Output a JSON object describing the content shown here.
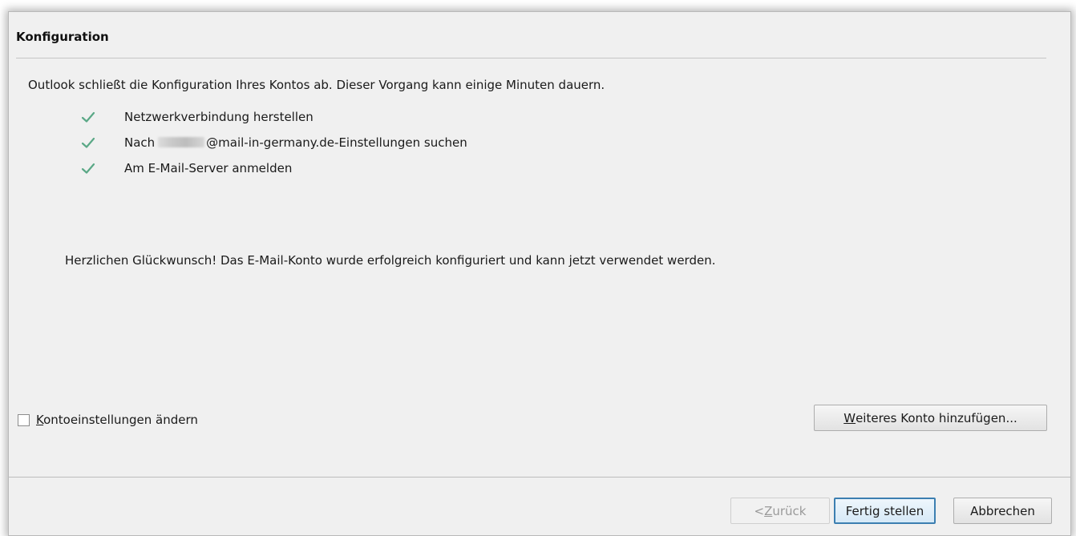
{
  "dialog": {
    "title": "Konfiguration",
    "intro": "Outlook schließt die Konfiguration Ihres Kontos ab. Dieser Vorgang kann einige Minuten dauern.",
    "steps": [
      {
        "status": "check-icon",
        "label": "Netzwerkverbindung herstellen"
      },
      {
        "status": "check-icon",
        "label_prefix": "Nach",
        "label_suffix": "@mail-in-germany.de-Einstellungen suchen"
      },
      {
        "status": "check-icon",
        "label": "Am E-Mail-Server anmelden"
      }
    ],
    "congratulations": "Herzlichen Glückwunsch! Das E-Mail-Konto wurde erfolgreich konfiguriert und kann jetzt verwendet werden."
  },
  "options": {
    "change_settings_accel": "K",
    "change_settings_rest": "ontoeinstellungen ändern",
    "add_account_accel": "W",
    "add_account_rest": "eiteres Konto hinzufügen..."
  },
  "footer": {
    "back_prefix": "< ",
    "back_accel": "Z",
    "back_rest": "urück",
    "finish_label": "Fertig stellen",
    "cancel_label": "Abbrechen"
  },
  "colors": {
    "check": "#5aa886",
    "dialog_background": "#f0f0f0",
    "default_button_border": "#3c7fb1"
  }
}
